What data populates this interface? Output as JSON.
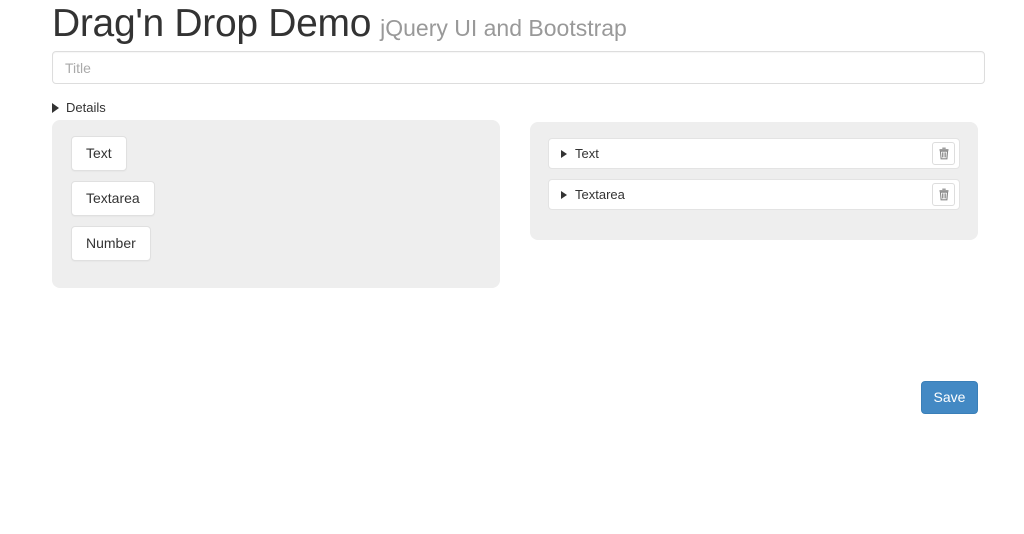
{
  "header": {
    "title": "Drag'n Drop Demo",
    "subtitle": "jQuery UI and Bootstrap"
  },
  "form": {
    "title_field": {
      "placeholder": "Title",
      "value": ""
    },
    "details_toggle": {
      "label": "Details",
      "caret_icon": "caret-right-icon"
    }
  },
  "source_panel": {
    "items": [
      {
        "label": "Text"
      },
      {
        "label": "Textarea"
      },
      {
        "label": "Number"
      }
    ]
  },
  "drop_panel": {
    "rows": [
      {
        "label": "Text",
        "caret_icon": "caret-right-icon",
        "delete_icon": "trash-icon"
      },
      {
        "label": "Textarea",
        "caret_icon": "caret-right-icon",
        "delete_icon": "trash-icon"
      }
    ]
  },
  "actions": {
    "save_label": "Save"
  },
  "colors": {
    "panel_background": "#eeeeee",
    "primary_button": "#4389c4",
    "page_background": "#ffffff",
    "subtitle_text": "#999999",
    "body_text": "#333333"
  }
}
